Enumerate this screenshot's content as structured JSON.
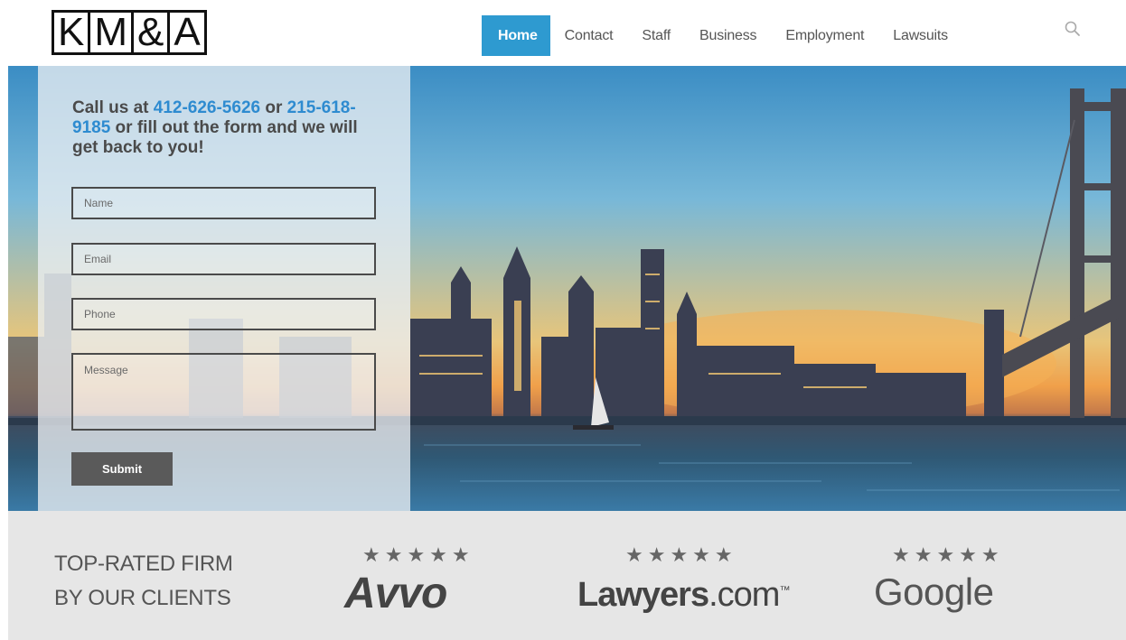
{
  "logo": {
    "letters": [
      "K",
      "M",
      "&",
      "A"
    ]
  },
  "nav": {
    "items": [
      {
        "label": "Home",
        "active": true
      },
      {
        "label": "Contact",
        "active": false
      },
      {
        "label": "Staff",
        "active": false
      },
      {
        "label": "Business",
        "active": false
      },
      {
        "label": "Employment",
        "active": false
      },
      {
        "label": "Lawsuits",
        "active": false
      }
    ],
    "search_icon": "search-icon",
    "active_color": "#2e9ad0"
  },
  "form": {
    "call_prefix": "Call us at ",
    "phone_1": "412-626-5626",
    "call_mid": " or ",
    "phone_2": "215-618-9185",
    "call_suffix": " or fill out the form and we will get back to you!",
    "fields": {
      "name_placeholder": "Name",
      "email_placeholder": "Email",
      "phone_placeholder": "Phone",
      "message_placeholder": "Message"
    },
    "submit_label": "Submit",
    "phone_color": "#2e8bd0"
  },
  "ratings": {
    "tagline_line1": "TOP-RATED FIRM",
    "tagline_line2": "BY OUR CLIENTS",
    "sites": [
      {
        "stars": "★★★★★",
        "rating": 5,
        "brand": "Avvo"
      },
      {
        "stars": "★★★★★",
        "rating": 5,
        "brand_main": "Lawyers",
        "brand_suffix": ".com",
        "brand_mark": "™"
      },
      {
        "stars": "★★★★★",
        "rating": 5,
        "brand": "Google"
      }
    ]
  }
}
